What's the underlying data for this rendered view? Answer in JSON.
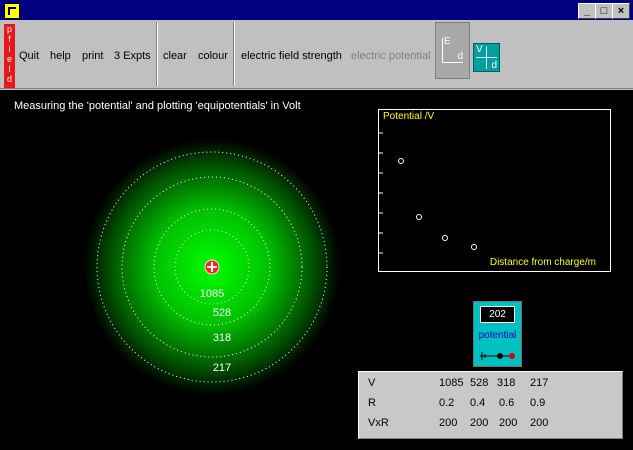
{
  "window": {
    "min": "_",
    "max": "□",
    "close": "×"
  },
  "toolbar": {
    "app_tag_letters": [
      "p",
      "f",
      "i",
      "e",
      "l",
      "d"
    ],
    "items": [
      "Quit",
      "help",
      "print",
      "3 Expts",
      "clear",
      "colour",
      "electric field strength",
      "electric potential"
    ],
    "ed_button": {
      "top": "E",
      "bottom": "d"
    },
    "vd_button": {
      "top": "V",
      "bottom": "d"
    }
  },
  "main": {
    "heading": "Measuring the 'potential' and plotting 'equipotentials' in Volt",
    "equipotential_labels": [
      "1085",
      "528",
      "318",
      "217"
    ]
  },
  "plot": {
    "title": "Potential /V",
    "xlabel": "Distance from charge/m"
  },
  "meter": {
    "reading": "202",
    "label": "potential"
  },
  "table": {
    "rows": [
      {
        "label": "V",
        "values": [
          "1085",
          "528",
          "318",
          "217"
        ]
      },
      {
        "label": "R",
        "values": [
          "0.2",
          "0.4",
          "0.6",
          "0.9"
        ]
      },
      {
        "label": "VxR",
        "values": [
          "200",
          "200",
          "200",
          "200"
        ]
      }
    ]
  },
  "colors": {
    "titlebar": "#000080",
    "field": "#00ff00",
    "plot_text": "#ffff00",
    "meter": "#00c0c0",
    "charge": "#ff0000"
  }
}
